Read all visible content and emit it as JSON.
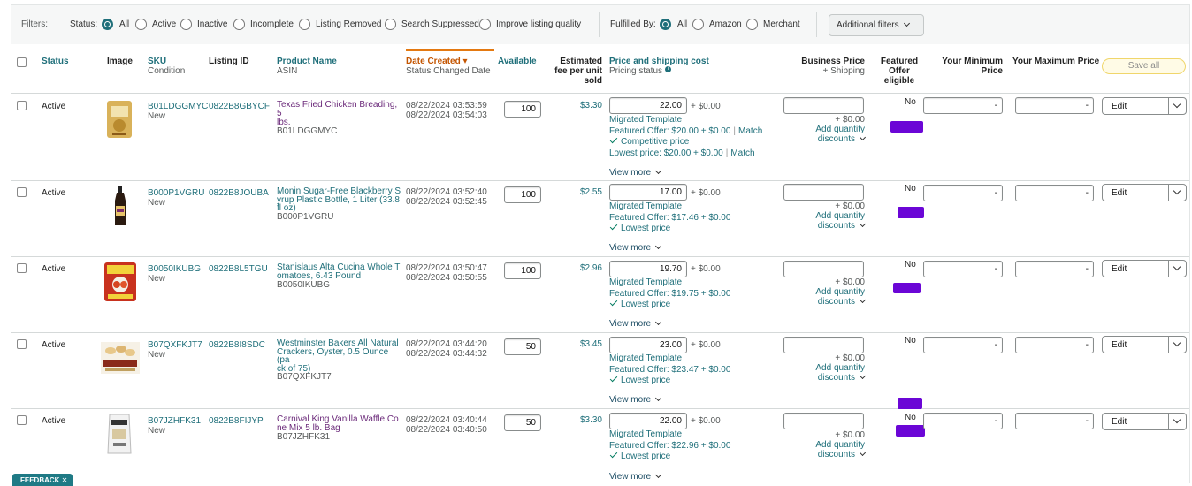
{
  "filters": {
    "label": "Filters:",
    "status_label": "Status:",
    "status_options": [
      "All",
      "Active",
      "Inactive",
      "Incomplete",
      "Listing Removed",
      "Search Suppressed",
      "Improve listing quality"
    ],
    "fulfilled_label": "Fulfilled By:",
    "fulfilled_options": [
      "All",
      "Amazon",
      "Merchant"
    ],
    "additional": "Additional filters"
  },
  "headers": {
    "status": "Status",
    "image": "Image",
    "sku": "SKU",
    "sku_sub": "Condition",
    "listing_id": "Listing ID",
    "product_name": "Product Name",
    "product_sub": "ASIN",
    "date_created": "Date Created ▾",
    "date_sub": "Status Changed Date",
    "available": "Available",
    "fee_l1": "Estimated",
    "fee_l2": "fee per unit",
    "fee_l3": "sold",
    "price": "Price and shipping cost",
    "price_sub": "Pricing status",
    "business": "Business Price",
    "business_sub": "+ Shipping",
    "featured_l1": "Featured",
    "featured_l2": "Offer",
    "featured_l3": "eligible",
    "min_l1": "Your Minimum",
    "min_l2": "Price",
    "max": "Your Maximum Price",
    "save_all": "Save all"
  },
  "common": {
    "migrated": "Migrated Template",
    "plus_zero": "+ $0.00",
    "add_qty_1": "Add quantity",
    "add_qty_2": "discounts",
    "view_more": "View more",
    "edit": "Edit",
    "dash": "-",
    "match": "Match",
    "feedback": "FEEDBACK ✕"
  },
  "rows": [
    {
      "status": "Active",
      "sku": "B01LDGGMYC",
      "condition": "New",
      "listing_id": "0822B8GBYCF",
      "name_1": "Texas Fried Chicken Breading, 5",
      "name_2": "lbs.",
      "name_3": "",
      "asin": "B01LDGGMYC",
      "date_created": "08/22/2024 03:53:59",
      "date_changed": "08/22/2024 03:54:03",
      "available": "100",
      "fee": "$3.30",
      "price": "22.00",
      "featured_offer": "Featured Offer: $20.00 + $0.00",
      "pricing_status": "Competitive price",
      "lowest": "Lowest price: $20.00 + $0.00",
      "featured_eligible": "No"
    },
    {
      "status": "Active",
      "sku": "B000P1VGRU",
      "condition": "New",
      "listing_id": "0822B8JOUBA",
      "name_1": "Monin Sugar-Free Blackberry S",
      "name_2": "yrup Plastic Bottle, 1 Liter (33.8",
      "name_3": "fl oz)",
      "asin": "B000P1VGRU",
      "date_created": "08/22/2024 03:52:40",
      "date_changed": "08/22/2024 03:52:45",
      "available": "100",
      "fee": "$2.55",
      "price": "17.00",
      "featured_offer": "Featured Offer: $17.46 + $0.00",
      "pricing_status": "Lowest price",
      "lowest": "",
      "featured_eligible": "No"
    },
    {
      "status": "Active",
      "sku": "B0050IKUBG",
      "condition": "New",
      "listing_id": "0822B8L5TGU",
      "name_1": "Stanislaus Alta Cucina Whole T",
      "name_2": "omatoes, 6.43 Pound",
      "name_3": "",
      "asin": "B0050IKUBG",
      "date_created": "08/22/2024 03:50:47",
      "date_changed": "08/22/2024 03:50:55",
      "available": "100",
      "fee": "$2.96",
      "price": "19.70",
      "featured_offer": "Featured Offer: $19.75 + $0.00",
      "pricing_status": "Lowest price",
      "lowest": "",
      "featured_eligible": "No"
    },
    {
      "status": "Active",
      "sku": "B07QXFKJT7",
      "condition": "New",
      "listing_id": "0822B8I8SDC",
      "name_1": "Westminster Bakers All Natural",
      "name_2": "Crackers, Oyster, 0.5 Ounce (pa",
      "name_3": "ck of 75)",
      "asin": "B07QXFKJT7",
      "date_created": "08/22/2024 03:44:20",
      "date_changed": "08/22/2024 03:44:32",
      "available": "50",
      "fee": "$3.45",
      "price": "23.00",
      "featured_offer": "Featured Offer: $23.47 + $0.00",
      "pricing_status": "Lowest price",
      "lowest": "",
      "featured_eligible": "No"
    },
    {
      "status": "Active",
      "sku": "B07JZHFK31",
      "condition": "New",
      "listing_id": "0822B8FIJYP",
      "name_1": "Carnival King Vanilla Waffle Co",
      "name_2": "ne Mix 5 lb. Bag",
      "name_3": "",
      "asin": "B07JZHFK31",
      "date_created": "08/22/2024 03:40:44",
      "date_changed": "08/22/2024 03:40:50",
      "available": "50",
      "fee": "$3.30",
      "price": "22.00",
      "featured_offer": "Featured Offer: $22.96 + $0.00",
      "pricing_status": "Lowest price",
      "lowest": "",
      "featured_eligible": "No"
    }
  ],
  "colors": {
    "teal": "#1f6f7a",
    "orange": "#c45500",
    "green": "#067d62",
    "redaction": "#6b06d6"
  }
}
